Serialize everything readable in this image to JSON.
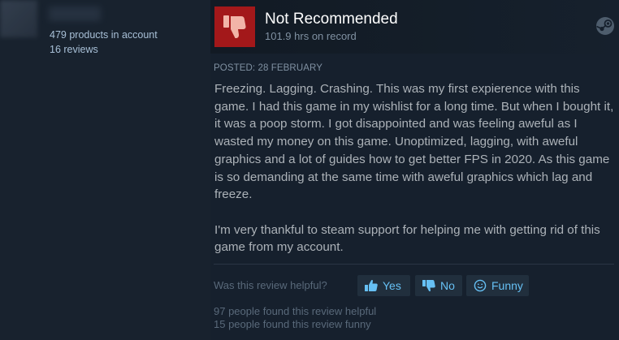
{
  "author": {
    "products_in_account": "479 products in account",
    "reviews_count": "16 reviews"
  },
  "review": {
    "recommendation": "Not Recommended",
    "hours_on_record": "101.9 hrs on record",
    "posted_date": "POSTED: 28 FEBRUARY",
    "paragraphs": [
      "Freezing. Lagging. Crashing. This was my first expierence with this game. I had this game in my wishlist for a long time. But when I bought it, it was a poop storm. I got disappointed and was feeling aweful as I wasted my money on this game. Unoptimized, lagging, with aweful graphics and a lot of guides how to get better FPS in 2020. As this game is so demanding at the same time with aweful graphics which lag and freeze.",
      "I'm very thankful to steam support for helping me with getting rid of this game from my account."
    ]
  },
  "voting": {
    "prompt": "Was this review helpful?",
    "yes_label": "Yes",
    "no_label": "No",
    "funny_label": "Funny",
    "helpful_count_text": "97 people found this review helpful",
    "funny_count_text": "15 people found this review funny"
  },
  "icons": {
    "recommendation_icon": "thumbs-down-icon",
    "platform_icon": "steam-icon",
    "yes_icon": "thumbs-up-icon",
    "no_icon": "thumbs-down-icon",
    "funny_icon": "smiley-icon"
  },
  "colors": {
    "not_recommended_red": "#a3181a",
    "link_blue": "#66c0f4",
    "background": "#1b2838"
  }
}
